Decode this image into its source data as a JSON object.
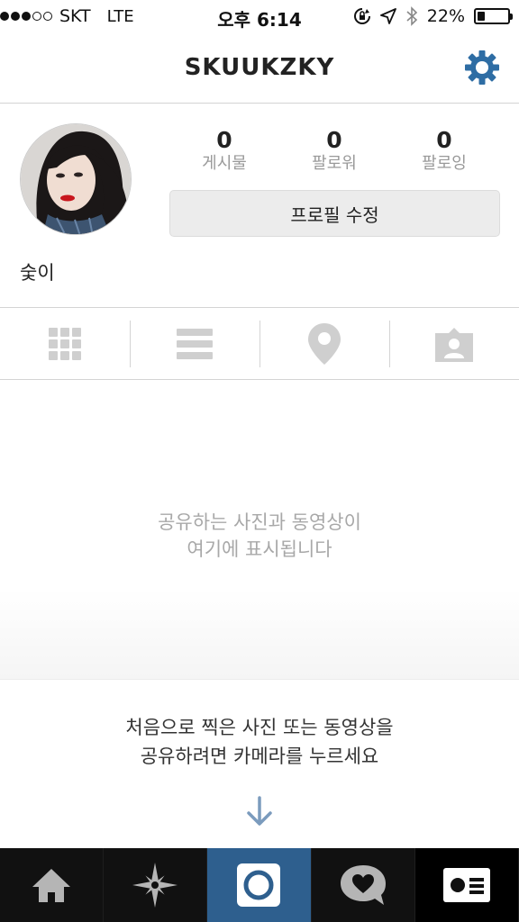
{
  "status_bar": {
    "carrier": "SKT",
    "network": "LTE",
    "time": "오후 6:14",
    "battery": "22%",
    "battery_level": 0.22,
    "signal_bars_filled": 3,
    "signal_bars_total": 5
  },
  "nav": {
    "title": "SKUUKZKY",
    "settings_icon": "gear-icon",
    "accent_color": "#2e6da4"
  },
  "profile": {
    "stats": [
      {
        "value": "0",
        "label": "게시물"
      },
      {
        "value": "0",
        "label": "팔로워"
      },
      {
        "value": "0",
        "label": "팔로잉"
      }
    ],
    "edit_button": "프로필 수정",
    "name": "숯이"
  },
  "tabs": [
    {
      "icon": "grid-icon"
    },
    {
      "icon": "list-icon"
    },
    {
      "icon": "location-pin-icon"
    },
    {
      "icon": "tagged-person-icon"
    }
  ],
  "empty_state": {
    "line1": "공유하는 사진과 동영상이",
    "line2": "여기에 표시됩니다"
  },
  "hint": {
    "line1": "처음으로 찍은 사진 또는 동영상을",
    "line2": "공유하려면 카메라를 누르세요",
    "arrow_icon": "arrow-down-icon"
  },
  "bottom_bar": [
    {
      "icon": "home-icon"
    },
    {
      "icon": "explore-star-icon"
    },
    {
      "icon": "camera-icon"
    },
    {
      "icon": "activity-heart-bubble-icon"
    },
    {
      "icon": "profile-card-icon"
    }
  ]
}
